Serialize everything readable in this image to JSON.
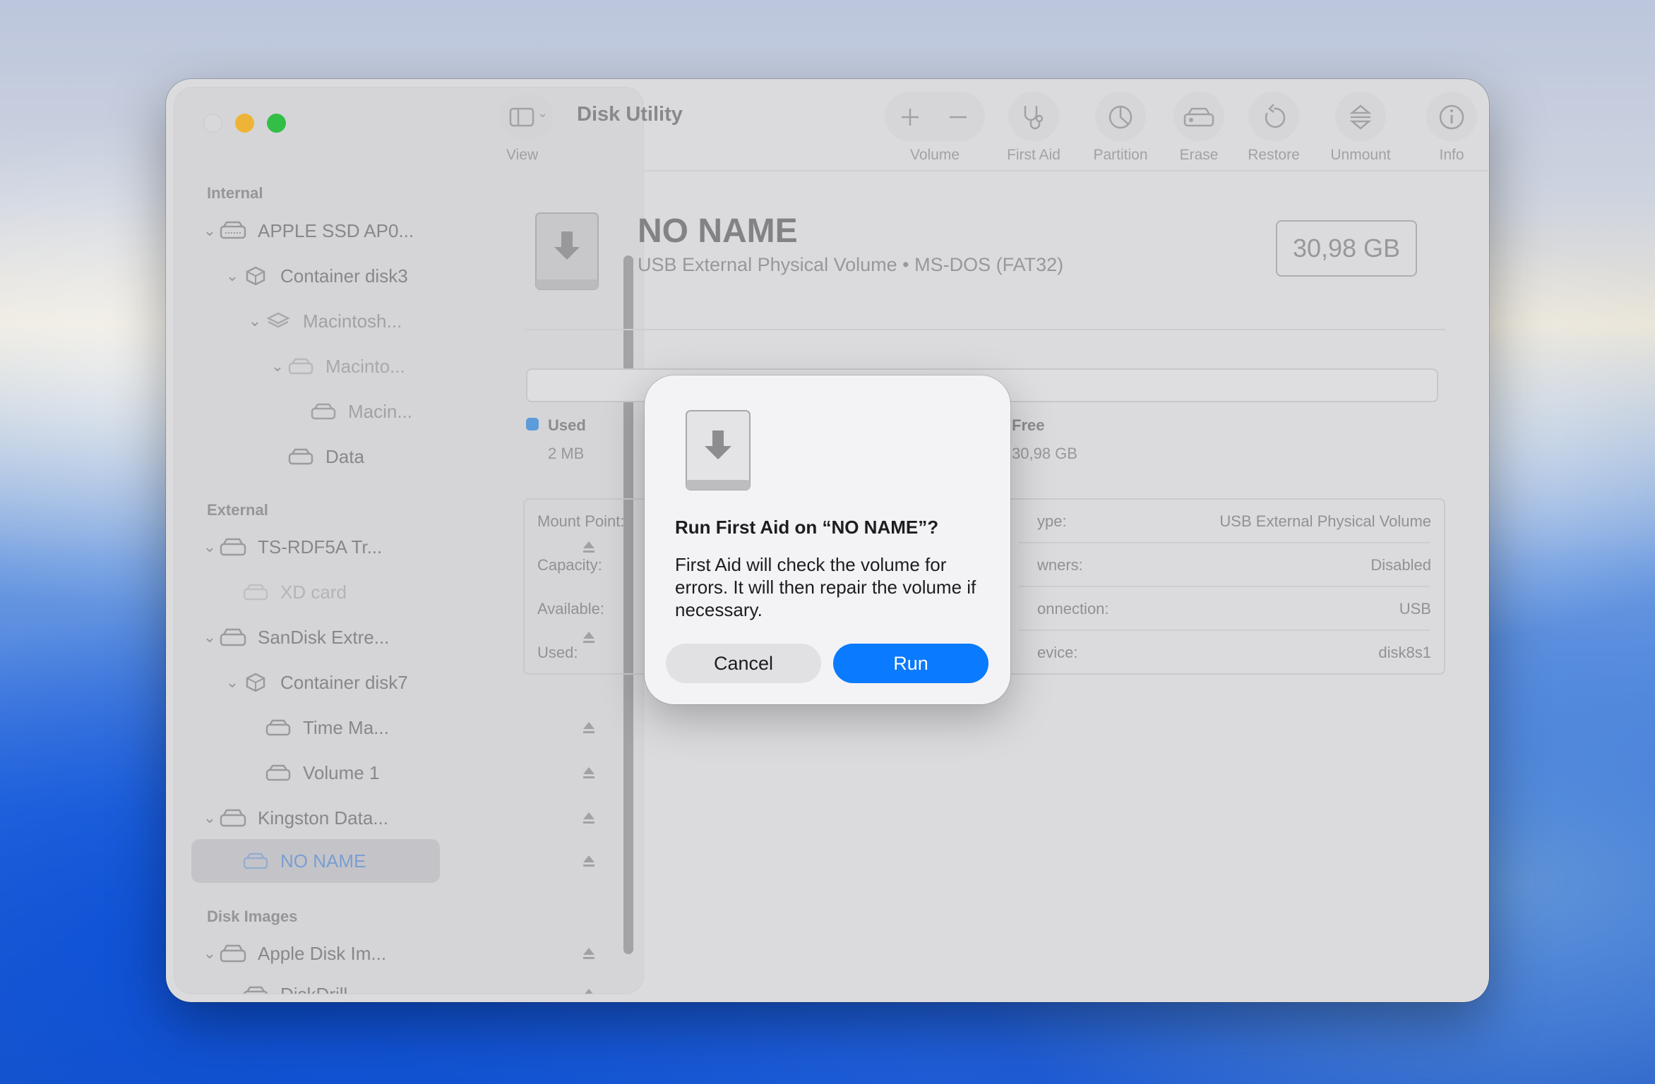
{
  "window": {
    "title": "Disk Utility",
    "view_label": "View"
  },
  "toolbar": {
    "volume_label": "Volume",
    "first_aid_label": "First Aid",
    "partition_label": "Partition",
    "erase_label": "Erase",
    "restore_label": "Restore",
    "unmount_label": "Unmount",
    "info_label": "Info"
  },
  "sidebar": {
    "section_internal": "Internal",
    "section_external": "External",
    "section_disk_images": "Disk Images",
    "items": [
      {
        "label": "APPLE SSD AP0..."
      },
      {
        "label": "Container disk3"
      },
      {
        "label": "Macintosh..."
      },
      {
        "label": "Macinto..."
      },
      {
        "label": "Macin..."
      },
      {
        "label": "Data"
      },
      {
        "label": "TS-RDF5A Tr..."
      },
      {
        "label": "XD card"
      },
      {
        "label": "SanDisk Extre..."
      },
      {
        "label": "Container disk7"
      },
      {
        "label": "Time Ma..."
      },
      {
        "label": "Volume 1"
      },
      {
        "label": "Kingston Data..."
      },
      {
        "label": "NO NAME"
      },
      {
        "label": "Apple Disk Im..."
      },
      {
        "label": "DiskDrill"
      }
    ]
  },
  "main": {
    "volume_name": "NO NAME",
    "volume_subtitle": "USB External Physical Volume • MS-DOS (FAT32)",
    "volume_size": "30,98 GB",
    "used_title": "Used",
    "used_value": "2 MB",
    "free_title": "Free",
    "free_value": "30,98 GB",
    "used_fraction": 0.0001,
    "colors": {
      "used": "#5aa0e8",
      "accent": "#0a7aff"
    },
    "info_left": [
      {
        "key": "Mount Point:"
      },
      {
        "key": "Capacity:"
      },
      {
        "key": "Available:"
      },
      {
        "key": "Used:"
      }
    ],
    "info_right": [
      {
        "key": "ype:",
        "value": "USB External Physical Volume"
      },
      {
        "key": "wners:",
        "value": "Disabled"
      },
      {
        "key": "onnection:",
        "value": "USB"
      },
      {
        "key": "evice:",
        "value": "disk8s1"
      }
    ]
  },
  "dialog": {
    "title": "Run First Aid on “NO NAME”?",
    "message": "First Aid will check the volume for errors. It will then repair the volume if necessary.",
    "cancel_label": "Cancel",
    "run_label": "Run"
  }
}
